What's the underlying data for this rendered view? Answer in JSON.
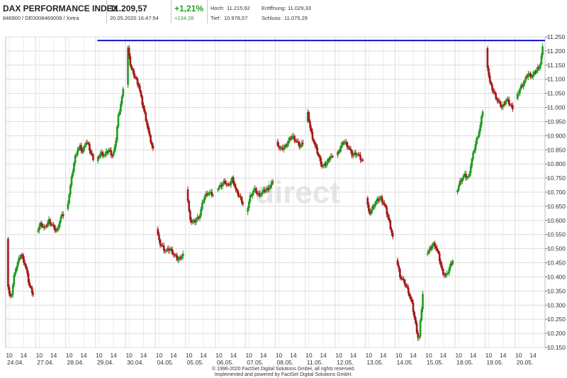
{
  "header": {
    "title": "DAX PERFORMANCE INDEX",
    "ids": "846900 / DE0008469008 / Xetra",
    "price": "11.209,57",
    "datetime": "20.05.2020 16:47:54",
    "change_pct": "+1,21%",
    "change_abs": "+134,28",
    "high_label": "Hoch:",
    "high_value": "11.215,62",
    "open_label": "Eröffnung:",
    "open_value": "11.029,33",
    "low_label": "Tief:",
    "low_value": "10.978,57",
    "close_label": "Schluss:",
    "close_value": "11.075,29"
  },
  "watermark": "direct",
  "footer": {
    "line1": "© 1996-2020 FactSet Digital Solutions GmbH, all rights reserved.",
    "line2": "Implemented and powered by FactSet Digital Solutions GmbH."
  },
  "colors": {
    "up": "#1f9a1f",
    "down": "#a31818",
    "reference_line": "#1414c8",
    "grid": "#dcdcdc"
  },
  "chart_data": {
    "type": "candlestick",
    "reference_line": 11237,
    "ylim": [
      10150,
      11250
    ],
    "yticks": [
      "10.150",
      "10.200",
      "10.250",
      "10.300",
      "10.350",
      "10.400",
      "10.450",
      "10.500",
      "10.550",
      "10.600",
      "10.650",
      "10.700",
      "10.750",
      "10.800",
      "10.850",
      "10.900",
      "10.950",
      "11.000",
      "11.050",
      "11.100",
      "11.150",
      "11.200",
      "11.250"
    ],
    "hour_labels": [
      "10",
      "14"
    ],
    "days": [
      {
        "date": "24.04.",
        "points": [
          [
            0,
            10535
          ],
          [
            0.05,
            10350
          ],
          [
            0.15,
            10320
          ],
          [
            0.3,
            10420
          ],
          [
            0.45,
            10460
          ],
          [
            0.55,
            10480
          ],
          [
            0.7,
            10440
          ],
          [
            0.85,
            10370
          ],
          [
            1,
            10340
          ]
        ]
      },
      {
        "date": "27.04.",
        "points": [
          [
            0,
            10560
          ],
          [
            0.15,
            10590
          ],
          [
            0.3,
            10570
          ],
          [
            0.45,
            10600
          ],
          [
            0.6,
            10580
          ],
          [
            0.75,
            10560
          ],
          [
            0.9,
            10610
          ],
          [
            1,
            10620
          ]
        ]
      },
      {
        "date": "28.04.",
        "points": [
          [
            0,
            10640
          ],
          [
            0.1,
            10700
          ],
          [
            0.2,
            10760
          ],
          [
            0.3,
            10820
          ],
          [
            0.4,
            10850
          ],
          [
            0.5,
            10860
          ],
          [
            0.6,
            10840
          ],
          [
            0.7,
            10880
          ],
          [
            0.8,
            10870
          ],
          [
            0.9,
            10840
          ],
          [
            1,
            10820
          ]
        ]
      },
      {
        "date": "29.04.",
        "points": [
          [
            0,
            10810
          ],
          [
            0.15,
            10840
          ],
          [
            0.3,
            10830
          ],
          [
            0.45,
            10850
          ],
          [
            0.6,
            10830
          ],
          [
            0.7,
            10860
          ],
          [
            0.8,
            10960
          ],
          [
            0.9,
            11010
          ],
          [
            1,
            11060
          ]
        ]
      },
      {
        "date": "30.04.",
        "points": [
          [
            0,
            11080
          ],
          [
            0.05,
            11220
          ],
          [
            0.15,
            11140
          ],
          [
            0.3,
            11110
          ],
          [
            0.45,
            11080
          ],
          [
            0.55,
            11030
          ],
          [
            0.65,
            10990
          ],
          [
            0.75,
            10950
          ],
          [
            0.85,
            10900
          ],
          [
            1,
            10850
          ]
        ]
      },
      {
        "date": "04.05.",
        "points": [
          [
            0,
            10570
          ],
          [
            0.1,
            10520
          ],
          [
            0.2,
            10510
          ],
          [
            0.35,
            10490
          ],
          [
            0.5,
            10500
          ],
          [
            0.65,
            10480
          ],
          [
            0.8,
            10460
          ],
          [
            1,
            10480
          ]
        ]
      },
      {
        "date": "05.05.",
        "points": [
          [
            0,
            10710
          ],
          [
            0.1,
            10620
          ],
          [
            0.2,
            10590
          ],
          [
            0.35,
            10600
          ],
          [
            0.5,
            10620
          ],
          [
            0.65,
            10680
          ],
          [
            0.8,
            10700
          ],
          [
            1,
            10690
          ]
        ]
      },
      {
        "date": "06.05.",
        "points": [
          [
            0,
            10710
          ],
          [
            0.15,
            10720
          ],
          [
            0.3,
            10740
          ],
          [
            0.45,
            10720
          ],
          [
            0.6,
            10750
          ],
          [
            0.75,
            10700
          ],
          [
            0.9,
            10680
          ],
          [
            1,
            10660
          ]
        ]
      },
      {
        "date": "07.05.",
        "points": [
          [
            0,
            10630
          ],
          [
            0.15,
            10690
          ],
          [
            0.3,
            10710
          ],
          [
            0.45,
            10690
          ],
          [
            0.6,
            10700
          ],
          [
            0.75,
            10710
          ],
          [
            0.9,
            10720
          ],
          [
            1,
            10740
          ]
        ]
      },
      {
        "date": "08.05.",
        "points": [
          [
            0,
            10880
          ],
          [
            0.15,
            10850
          ],
          [
            0.3,
            10860
          ],
          [
            0.45,
            10880
          ],
          [
            0.6,
            10900
          ],
          [
            0.75,
            10880
          ],
          [
            0.9,
            10860
          ],
          [
            1,
            10880
          ]
        ]
      },
      {
        "date": "11.05.",
        "points": [
          [
            0,
            10950
          ],
          [
            0.05,
            10980
          ],
          [
            0.15,
            10920
          ],
          [
            0.3,
            10870
          ],
          [
            0.45,
            10830
          ],
          [
            0.6,
            10790
          ],
          [
            0.75,
            10800
          ],
          [
            0.9,
            10830
          ],
          [
            1,
            10820
          ]
        ]
      },
      {
        "date": "12.05.",
        "points": [
          [
            0,
            10830
          ],
          [
            0.15,
            10860
          ],
          [
            0.3,
            10880
          ],
          [
            0.45,
            10860
          ],
          [
            0.6,
            10830
          ],
          [
            0.75,
            10840
          ],
          [
            0.9,
            10820
          ],
          [
            1,
            10810
          ]
        ]
      },
      {
        "date": "13.05.",
        "points": [
          [
            0,
            10680
          ],
          [
            0.1,
            10620
          ],
          [
            0.25,
            10650
          ],
          [
            0.4,
            10670
          ],
          [
            0.55,
            10680
          ],
          [
            0.7,
            10650
          ],
          [
            0.85,
            10600
          ],
          [
            1,
            10540
          ]
        ]
      },
      {
        "date": "14.05.",
        "points": [
          [
            0,
            10460
          ],
          [
            0.15,
            10400
          ],
          [
            0.3,
            10380
          ],
          [
            0.45,
            10350
          ],
          [
            0.6,
            10300
          ],
          [
            0.75,
            10220
          ],
          [
            0.85,
            10170
          ],
          [
            0.9,
            10230
          ],
          [
            1,
            10340
          ]
        ]
      },
      {
        "date": "15.05.",
        "points": [
          [
            0,
            10480
          ],
          [
            0.15,
            10500
          ],
          [
            0.3,
            10520
          ],
          [
            0.45,
            10480
          ],
          [
            0.6,
            10420
          ],
          [
            0.75,
            10400
          ],
          [
            0.9,
            10440
          ],
          [
            1,
            10460
          ]
        ]
      },
      {
        "date": "18.05.",
        "points": [
          [
            0,
            10700
          ],
          [
            0.15,
            10740
          ],
          [
            0.3,
            10760
          ],
          [
            0.45,
            10750
          ],
          [
            0.6,
            10820
          ],
          [
            0.75,
            10880
          ],
          [
            0.9,
            10930
          ],
          [
            1,
            10990
          ]
        ]
      },
      {
        "date": "19.05.",
        "points": [
          [
            0,
            11210
          ],
          [
            0.05,
            11140
          ],
          [
            0.15,
            11080
          ],
          [
            0.3,
            11050
          ],
          [
            0.45,
            11020
          ],
          [
            0.6,
            11000
          ],
          [
            0.75,
            11030
          ],
          [
            0.9,
            11010
          ],
          [
            1,
            11000
          ]
        ]
      },
      {
        "date": "20.05.",
        "points": [
          [
            0,
            11030
          ],
          [
            0.15,
            11070
          ],
          [
            0.3,
            11090
          ],
          [
            0.45,
            11120
          ],
          [
            0.6,
            11110
          ],
          [
            0.75,
            11130
          ],
          [
            0.9,
            11150
          ],
          [
            1,
            11210
          ]
        ]
      }
    ]
  }
}
